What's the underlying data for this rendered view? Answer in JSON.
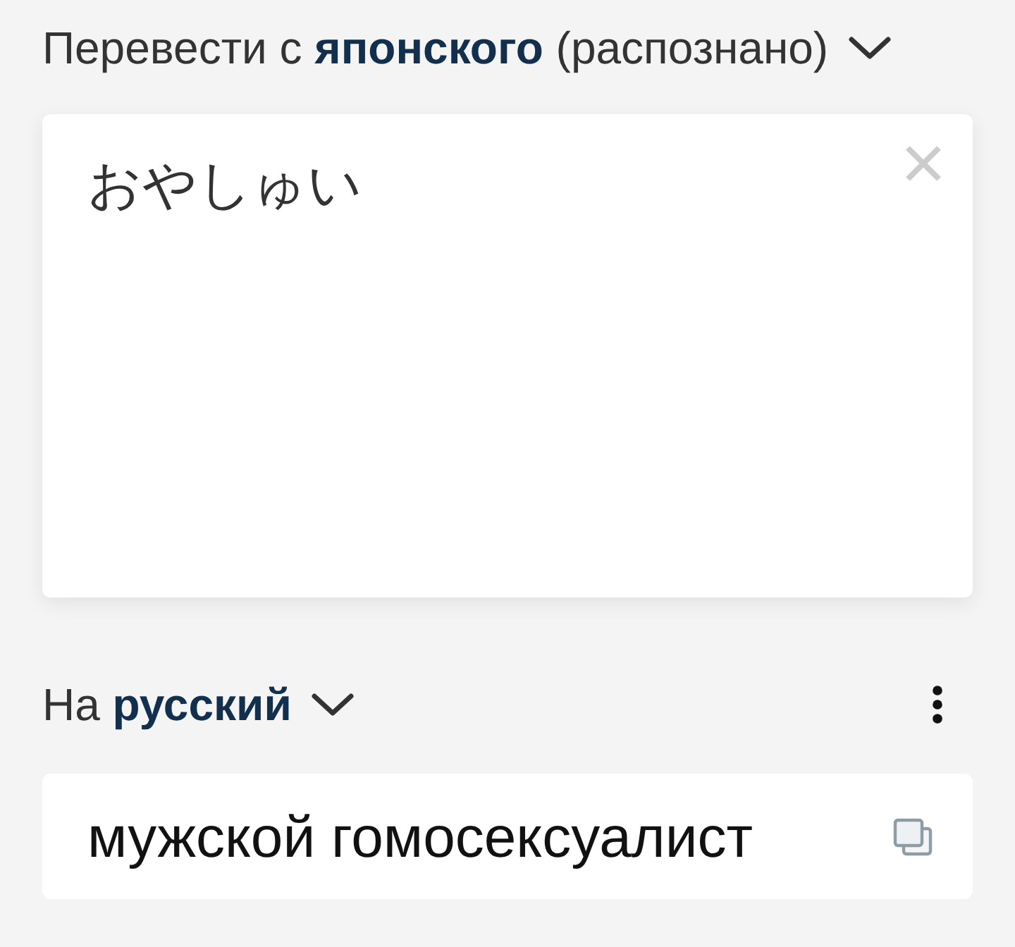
{
  "source": {
    "language_label": "Перевести с **японского** (распознано)",
    "text": "おやしゅい"
  },
  "target": {
    "language_label": "На **русский**",
    "text": "мужской гомосексуалист"
  }
}
